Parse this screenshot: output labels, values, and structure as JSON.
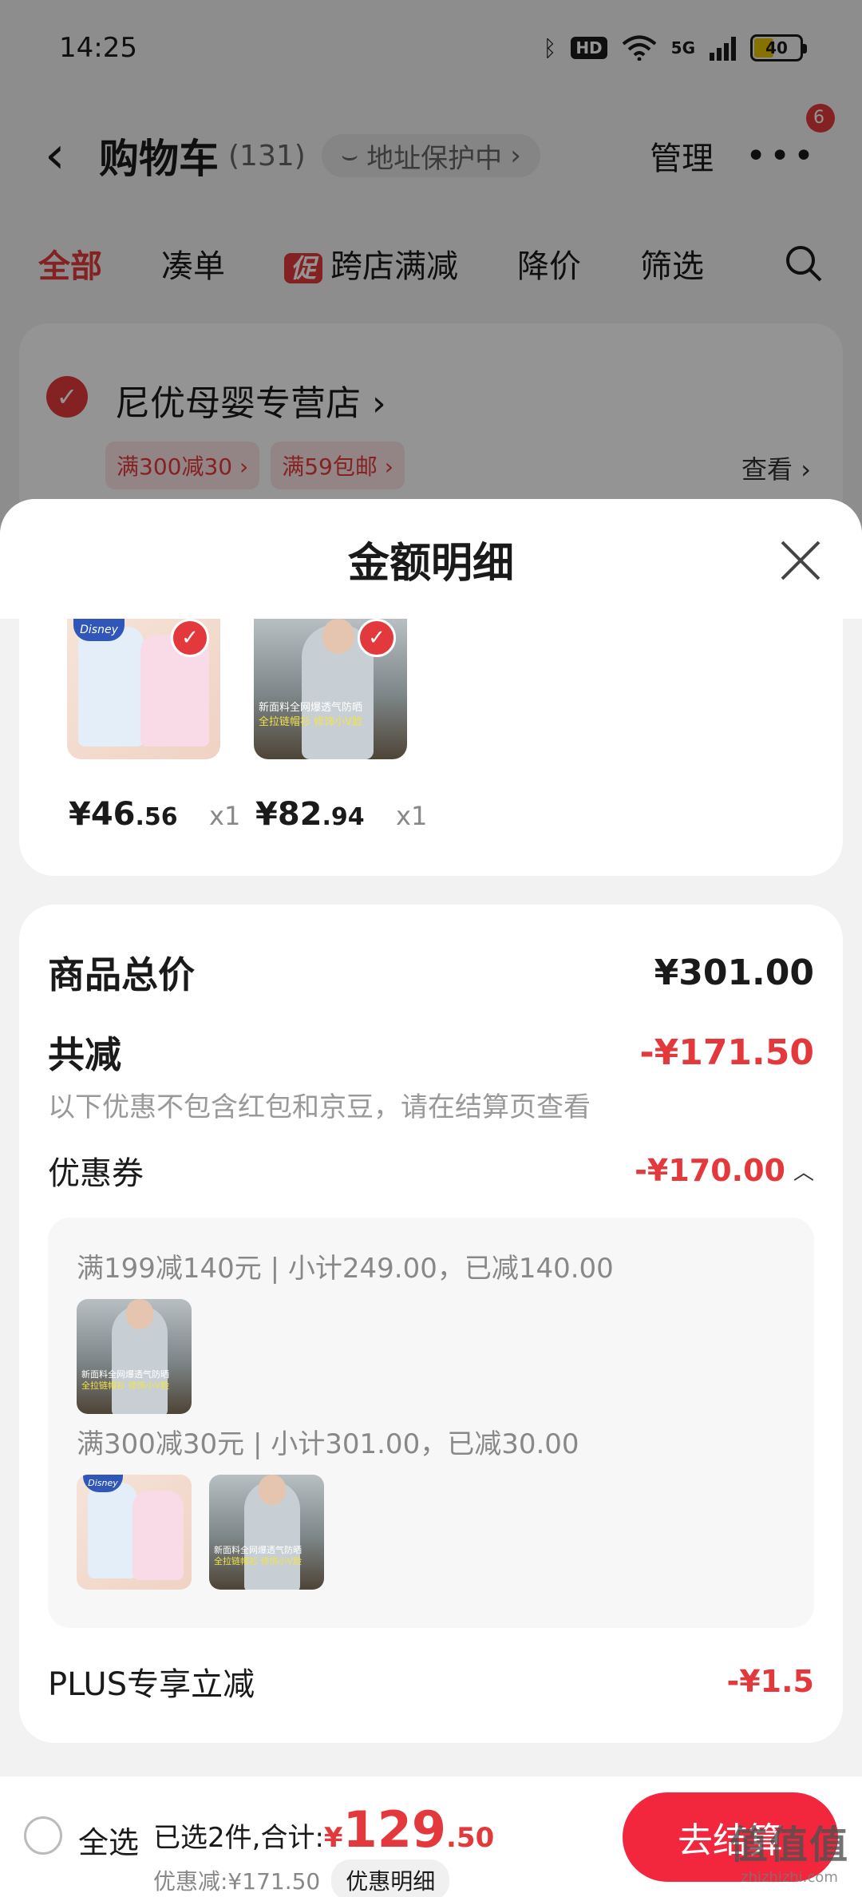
{
  "status_bar": {
    "time": "14:25",
    "network": "5G",
    "hd": "HD",
    "battery": "40"
  },
  "header": {
    "title": "购物车",
    "count": "(131)",
    "address_pill": "地址保护中",
    "manage": "管理",
    "more_badge": "6"
  },
  "filter_tabs": {
    "all": "全部",
    "bundle": "凑单",
    "promo_tag": "促",
    "cross_store": "跨店满减",
    "price_drop": "降价",
    "filter": "筛选"
  },
  "store": {
    "name": "尼优母婴专营店",
    "tags": [
      "满300减30",
      "满59包邮"
    ],
    "view": "查看"
  },
  "sheet": {
    "title": "金额明细",
    "products": [
      {
        "price_int": "¥46",
        "price_dec": ".56",
        "qty": "x1",
        "thumb": "vest"
      },
      {
        "price_int": "¥82",
        "price_dec": ".94",
        "qty": "x1",
        "thumb": "jacket"
      }
    ],
    "thumb_text": {
      "brand": "Disney",
      "caption1": "新面料全网爆透气防晒",
      "caption2": "全拉链帽衫 修饰小V脸"
    },
    "summary": {
      "total_label": "商品总价",
      "total_value": "¥301.00",
      "reduce_label": "共减",
      "reduce_value": "-¥171.50",
      "reduce_note": "以下优惠不包含红包和京豆，请在结算页查看",
      "coupon_label": "优惠券",
      "coupon_value": "-¥170.00",
      "coupon_lines": [
        "满199减140元 | 小计249.00，已减140.00",
        "满300减30元 | 小计301.00，已减30.00"
      ],
      "plus_label": "PLUS专享立减",
      "plus_value": "-¥1.5"
    }
  },
  "bottom_bar": {
    "select_all": "全选",
    "selected_label": "已选2件,合计:",
    "currency": "¥",
    "total_int": "129",
    "total_dec": ".50",
    "discount_text": "优惠减:¥171.50",
    "discount_detail": "优惠明细",
    "checkout": "去结算"
  },
  "watermark": {
    "big": "值值值",
    "small": "zhizhizhi.com"
  },
  "colors": {
    "accent": "#e4393c",
    "checkout": "#f2273e"
  }
}
